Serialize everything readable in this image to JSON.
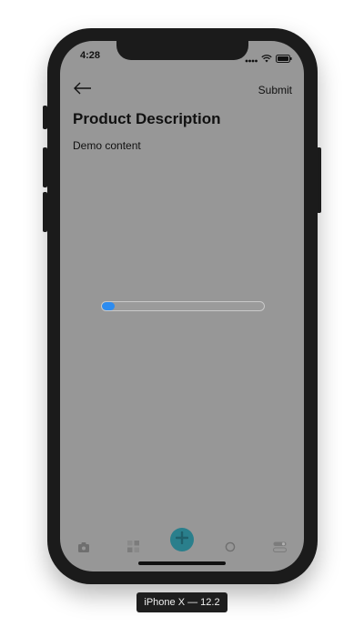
{
  "device": {
    "label": "iPhone X — 12.2"
  },
  "status_bar": {
    "time": "4:28",
    "icons": [
      "signal-icon",
      "wifi-icon",
      "battery-icon"
    ]
  },
  "nav": {
    "back_icon": "arrow-left-icon",
    "submit_label": "Submit"
  },
  "content": {
    "title": "Product Description",
    "text": "Demo content"
  },
  "progress": {
    "value_fraction": 0.08,
    "fill_color": "#2d8cf0"
  },
  "tab_bar": {
    "items": [
      {
        "icon": "home-icon"
      },
      {
        "icon": "grid-icon"
      },
      {
        "icon": "plus-icon",
        "accent": "#2a7f8c"
      },
      {
        "icon": "circle-icon"
      },
      {
        "icon": "toggle-icon"
      }
    ]
  },
  "colors": {
    "screen_overlay": "#979797",
    "phone_frame": "#1b1b1b"
  }
}
